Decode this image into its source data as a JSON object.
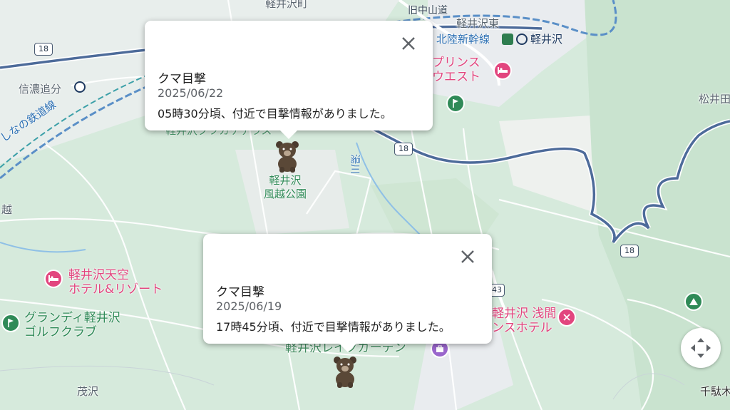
{
  "map": {
    "places": {
      "karuizawa_machi": "軽井沢町",
      "shinano_oiwake": "信濃追分",
      "karuizawa_higashi": "軽井沢東",
      "matsuida": "松井田",
      "ko": "越",
      "shigesawa": "茂沢",
      "sendaki": "千駄木"
    },
    "rail": {
      "hokuriku": "北陸新幹線",
      "station": "軽井沢",
      "shinano_railway": "しなの鉄道線"
    },
    "roads": {
      "kyu_nakasendo": "旧中山道",
      "route18": "18",
      "route43": "43",
      "river": "湯川"
    },
    "pois": {
      "prince_west": "プリンス\nウエスト",
      "tenku_hotel": "軽井沢天空\nホテル&リゾート",
      "grandy_golf": "グランディ軽井沢\nゴルフクラブ",
      "asama_hotel": "軽井沢 浅間\nンスホテル",
      "lake_garden": "軽井沢レイクガーデン",
      "kazakoshi_park": "軽井沢\n風越公園",
      "kutsukake": "軽井沢クツカケテラス"
    },
    "colors": {
      "background": "#dfeee3",
      "road_major": "#4d6b9a",
      "poi_pink": "#e2457e",
      "poi_green": "#2f8a57"
    }
  },
  "popups": [
    {
      "title": "クマ目撃",
      "date": "2025/06/22",
      "message": "05時30分頃、付近で目撃情報がありました。",
      "close_label": "×"
    },
    {
      "title": "クマ目撃",
      "date": "2025/06/19",
      "message": "17時45分頃、付近で目撃情報がありました。",
      "close_label": "×"
    }
  ],
  "controls": {
    "locate_icon": "locate-icon"
  }
}
